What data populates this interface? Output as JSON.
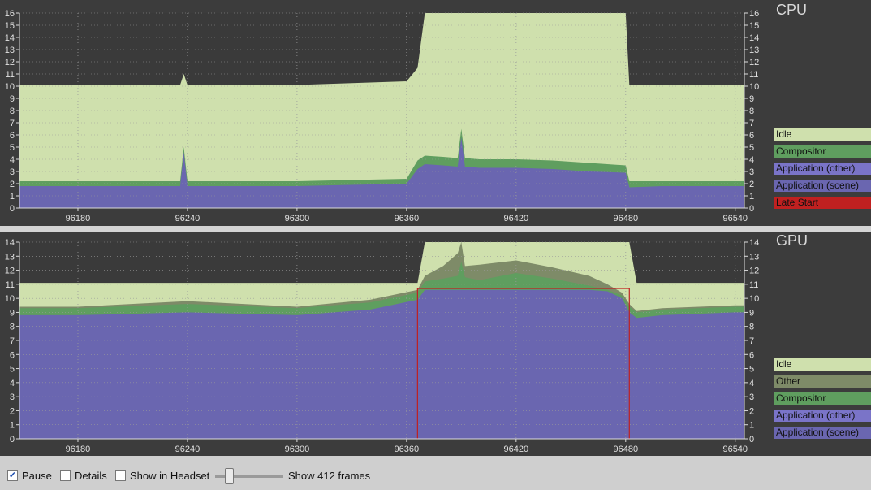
{
  "cpu": {
    "title": "CPU",
    "legend": [
      {
        "label": "Idle",
        "color": "#cfe0ad"
      },
      {
        "label": "Compositor",
        "color": "#5f9e5f"
      },
      {
        "label": "Application (other)",
        "color": "#7a74c8"
      },
      {
        "label": "Application (scene)",
        "color": "#6a66b0"
      },
      {
        "label": "Late Start",
        "color": "#c02020"
      }
    ]
  },
  "gpu": {
    "title": "GPU",
    "legend": [
      {
        "label": "Idle",
        "color": "#cfe0ad"
      },
      {
        "label": "Other",
        "color": "#7e8b68"
      },
      {
        "label": "Compositor",
        "color": "#5f9e5f"
      },
      {
        "label": "Application (other)",
        "color": "#7a74c8"
      },
      {
        "label": "Application (scene)",
        "color": "#6a66b0"
      }
    ]
  },
  "toolbar": {
    "pause_label": "Pause",
    "pause_checked": true,
    "details_label": "Details",
    "details_checked": false,
    "headset_label": "Show in Headset",
    "headset_checked": false,
    "frames_label": "Show 412 frames"
  },
  "chart_data": [
    {
      "type": "area",
      "title": "CPU",
      "xlim": [
        96148,
        96545
      ],
      "ylim": [
        0,
        16
      ],
      "x_ticks": [
        96180,
        96240,
        96300,
        96360,
        96420,
        96480,
        96540
      ],
      "y_ticks": [
        0,
        1,
        2,
        3,
        4,
        5,
        6,
        7,
        8,
        9,
        10,
        11,
        12,
        13,
        14,
        15,
        16
      ],
      "grid": true,
      "legend_position": "right",
      "x": [
        96148,
        96180,
        96236,
        96238,
        96240,
        96300,
        96360,
        96366,
        96370,
        96380,
        96388,
        96390,
        96392,
        96400,
        96420,
        96440,
        96460,
        96480,
        96482,
        96500,
        96540,
        96545
      ],
      "series": [
        {
          "name": "Application (scene)",
          "values": [
            1.8,
            1.8,
            1.8,
            4.6,
            1.8,
            1.8,
            2.0,
            3.2,
            3.6,
            3.5,
            3.4,
            5.8,
            3.4,
            3.3,
            3.3,
            3.2,
            3.0,
            2.9,
            1.7,
            1.8,
            1.8,
            1.8
          ]
        },
        {
          "name": "Compositor",
          "values": [
            2.2,
            2.2,
            2.2,
            5.0,
            2.2,
            2.2,
            2.4,
            3.9,
            4.3,
            4.2,
            4.1,
            6.5,
            4.1,
            4.0,
            4.0,
            3.9,
            3.7,
            3.5,
            2.2,
            2.2,
            2.2,
            2.2
          ]
        },
        {
          "name": "Idle",
          "values": [
            10.1,
            10.1,
            10.1,
            11.0,
            10.1,
            10.1,
            10.4,
            11.5,
            16,
            16,
            16,
            16,
            16,
            16,
            16,
            16,
            16,
            16,
            10.1,
            10.1,
            10.1,
            10.1
          ]
        }
      ]
    },
    {
      "type": "area",
      "title": "GPU",
      "xlim": [
        96148,
        96545
      ],
      "ylim": [
        0,
        14
      ],
      "x_ticks": [
        96180,
        96240,
        96300,
        96360,
        96420,
        96480,
        96540
      ],
      "y_ticks": [
        0,
        1,
        2,
        3,
        4,
        5,
        6,
        7,
        8,
        9,
        10,
        11,
        12,
        13,
        14
      ],
      "grid": true,
      "legend_position": "right",
      "x": [
        96148,
        96180,
        96240,
        96300,
        96340,
        96366,
        96370,
        96380,
        96388,
        96390,
        96392,
        96400,
        96420,
        96440,
        96460,
        96470,
        96478,
        96482,
        96486,
        96500,
        96540,
        96545
      ],
      "series": [
        {
          "name": "Application (scene)",
          "values": [
            8.8,
            8.8,
            9.0,
            8.8,
            9.2,
            9.9,
            10.6,
            10.6,
            10.6,
            10.6,
            10.6,
            10.6,
            10.6,
            10.6,
            10.6,
            10.5,
            10.0,
            9.0,
            8.6,
            8.8,
            9.0,
            9.0
          ]
        },
        {
          "name": "Compositor",
          "values": [
            9.3,
            9.3,
            9.6,
            9.3,
            9.7,
            10.4,
            11.2,
            11.4,
            11.6,
            12.6,
            11.5,
            11.3,
            11.8,
            11.4,
            10.9,
            10.6,
            10.2,
            9.4,
            9.0,
            9.2,
            9.4,
            9.4
          ]
        },
        {
          "name": "Other",
          "values": [
            9.4,
            9.4,
            9.8,
            9.4,
            9.9,
            10.6,
            11.6,
            12.3,
            13.2,
            14.0,
            12.3,
            12.4,
            12.7,
            12.2,
            11.6,
            11.0,
            10.4,
            9.6,
            9.1,
            9.3,
            9.5,
            9.5
          ]
        },
        {
          "name": "Idle",
          "values": [
            11.1,
            11.1,
            11.1,
            11.1,
            11.1,
            11.1,
            14,
            14,
            14,
            14,
            14,
            14,
            14,
            14,
            14,
            14,
            14,
            14,
            11.1,
            11.1,
            11.1,
            11.1
          ]
        }
      ],
      "frame_time_marker": {
        "x_start": 96366,
        "x_end": 96482,
        "y": 10.7
      }
    }
  ]
}
